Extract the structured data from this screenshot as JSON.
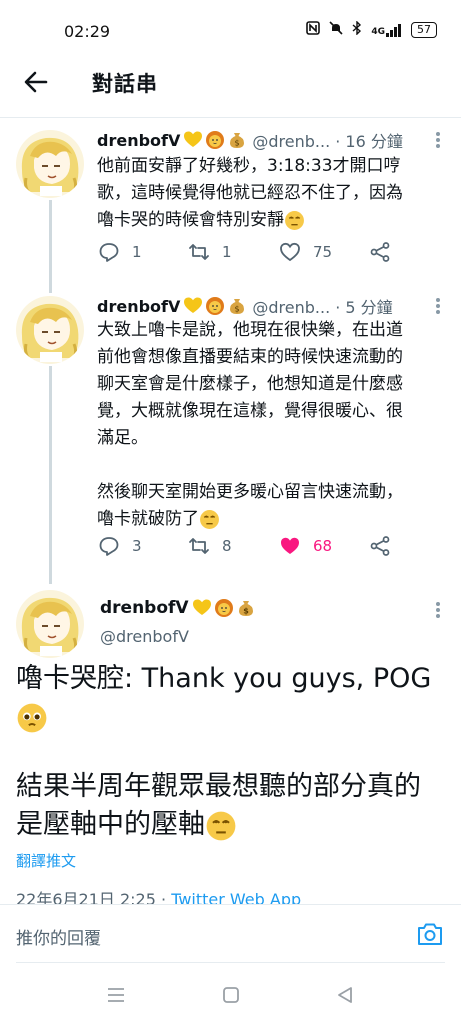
{
  "status_bar": {
    "time": "02:29",
    "network": "4G",
    "battery": "57"
  },
  "header": {
    "title": "對話串"
  },
  "colors": {
    "accent": "#1d9bf0",
    "like": "#f91880",
    "muted": "#536471",
    "thread_line": "#cfd9de"
  },
  "tweets": [
    {
      "name": "drenbofV",
      "handle_time": "@drenb... · 16 分鐘",
      "lines": [
        "他前面安靜了好幾秒，3:18:33才開口哼",
        "歌，這時候覺得他就已經忍不住了，因為",
        "嚕卡哭的時候會特別安靜"
      ],
      "replies": "1",
      "retweets": "1",
      "likes": "75",
      "liked": false
    },
    {
      "name": "drenbofV",
      "handle_time": "@drenb... · 5 分鐘",
      "lines": [
        "大致上嚕卡是說，他現在很快樂，在出道",
        "前他會想像直播要結束的時候快速流動的",
        "聊天室會是什麼樣子，他想知道是什麼感",
        "覺，大概就像現在這樣，覺得很暖心、很",
        "滿足。"
      ],
      "lines2": [
        "然後聊天室開始更多暖心留言快速流動，",
        "嚕卡就破防了"
      ],
      "replies": "3",
      "retweets": "8",
      "likes": "68",
      "liked": true
    }
  ],
  "main_tweet": {
    "name": "drenbofV",
    "handle": "@drenbofV",
    "line1": "嚕卡哭腔: Thank you guys, POG",
    "line2": "結果半周年觀眾最想聽的部分真的",
    "line3": "是壓軸中的壓軸",
    "translate": "翻譯推文",
    "date": "22年6月21日 2:25 · ",
    "source": "Twitter Web App"
  },
  "reply_bar": {
    "placeholder": "推你的回覆"
  },
  "icons": [
    "back-arrow-icon",
    "reply-icon",
    "retweet-icon",
    "heart-icon",
    "share-icon",
    "more-icon",
    "camera-icon",
    "nfc-icon",
    "mute-icon",
    "bluetooth-icon",
    "signal-icon",
    "battery-icon",
    "nav-menu-icon",
    "nav-home-icon",
    "nav-back-icon"
  ]
}
